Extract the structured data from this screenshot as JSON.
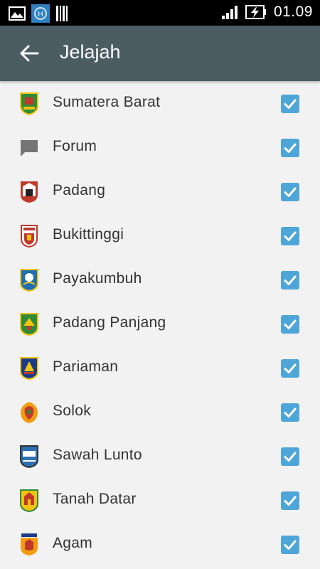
{
  "status_bar": {
    "time": "01.09",
    "icons": [
      "image-icon",
      "app-h-icon",
      "barcode-icon",
      "signal-icon",
      "battery-charging-icon"
    ]
  },
  "app_bar": {
    "title": "Jelajah",
    "back_icon": "arrow-back-icon"
  },
  "items": [
    {
      "label": "Sumatera Barat",
      "checked": true,
      "icon": "sumbar-crest-icon",
      "colors": [
        "#2e8b3a",
        "#c0392b",
        "#f1c40f"
      ]
    },
    {
      "label": "Forum",
      "checked": true,
      "icon": "forum-chat-icon",
      "colors": [
        "#757575",
        "#757575",
        "#757575"
      ]
    },
    {
      "label": "Padang",
      "checked": true,
      "icon": "padang-crest-icon",
      "colors": [
        "#c0392b",
        "#ffffff",
        "#222222"
      ]
    },
    {
      "label": "Bukittinggi",
      "checked": true,
      "icon": "bukittinggi-crest-icon",
      "colors": [
        "#c0392b",
        "#f1c40f",
        "#ffffff"
      ]
    },
    {
      "label": "Payakumbuh",
      "checked": true,
      "icon": "payakumbuh-crest-icon",
      "colors": [
        "#1f6fb2",
        "#f1c40f",
        "#ffffff"
      ]
    },
    {
      "label": "Padang Panjang",
      "checked": true,
      "icon": "padang-panjang-crest-icon",
      "colors": [
        "#2e8b3a",
        "#f1c40f",
        "#c0392b"
      ]
    },
    {
      "label": "Pariaman",
      "checked": true,
      "icon": "pariaman-crest-icon",
      "colors": [
        "#1a3a8a",
        "#f1c40f",
        "#c0392b"
      ]
    },
    {
      "label": "Solok",
      "checked": true,
      "icon": "solok-crest-icon",
      "colors": [
        "#f39c12",
        "#c0392b",
        "#2e8b3a"
      ]
    },
    {
      "label": "Sawah Lunto",
      "checked": true,
      "icon": "sawah-lunto-crest-icon",
      "colors": [
        "#2c6fb2",
        "#ffffff",
        "#333333"
      ]
    },
    {
      "label": "Tanah Datar",
      "checked": true,
      "icon": "tanah-datar-crest-icon",
      "colors": [
        "#f1c40f",
        "#c0392b",
        "#2e8b3a"
      ]
    },
    {
      "label": "Agam",
      "checked": true,
      "icon": "agam-crest-icon",
      "colors": [
        "#f39c12",
        "#c0392b",
        "#1a3a8a"
      ]
    }
  ],
  "theme": {
    "appbar_color": "#4b5d63",
    "checkbox_color": "#4ea6d8",
    "background": "#f2f2f2"
  }
}
